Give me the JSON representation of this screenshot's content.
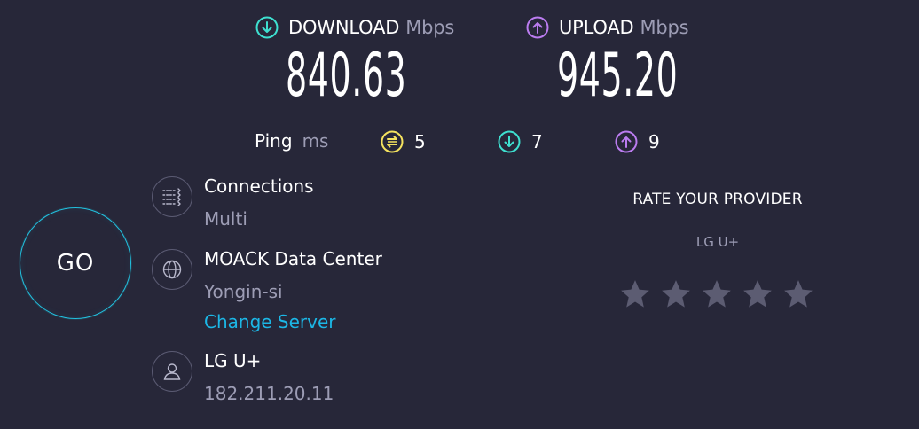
{
  "download": {
    "label": "DOWNLOAD",
    "unit": "Mbps",
    "value": "840.63",
    "icon": "arrow-down-circle-icon",
    "color": "#3ee0d0"
  },
  "upload": {
    "label": "UPLOAD",
    "unit": "Mbps",
    "value": "945.20",
    "icon": "arrow-up-circle-icon",
    "color": "#bb7cf0"
  },
  "ping": {
    "label": "Ping",
    "unit": "ms",
    "idle": {
      "value": "5",
      "icon": "ping-idle-icon",
      "color": "#f5e35f"
    },
    "download": {
      "value": "7",
      "icon": "arrow-down-circle-icon",
      "color": "#3ee0d0"
    },
    "upload": {
      "value": "9",
      "icon": "arrow-up-circle-icon",
      "color": "#bb7cf0"
    }
  },
  "go_button": {
    "label": "GO",
    "color": "#22c2e0"
  },
  "connections": {
    "title": "Connections",
    "value": "Multi",
    "icon": "connections-icon"
  },
  "server": {
    "title": "MOACK Data Center",
    "location": "Yongin-si",
    "change_label": "Change Server",
    "icon": "globe-icon"
  },
  "provider": {
    "name": "LG U+",
    "ip": "182.211.20.11",
    "icon": "user-icon"
  },
  "rating": {
    "title": "RATE YOUR PROVIDER",
    "provider": "LG U+",
    "max_stars": 5,
    "selected_stars": 0,
    "star_color": "#5c5c72"
  }
}
